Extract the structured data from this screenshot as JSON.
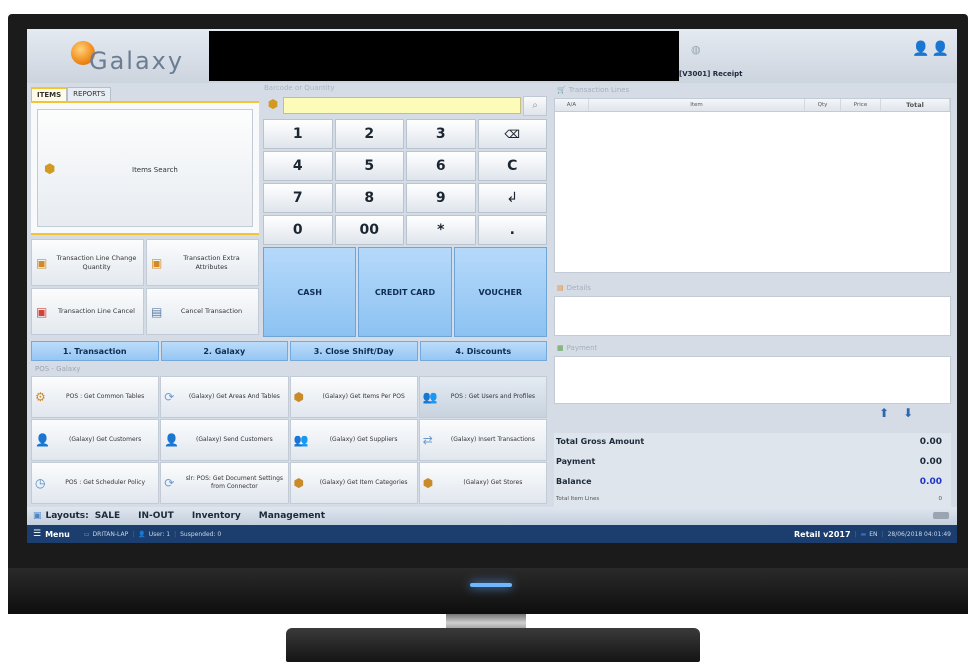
{
  "header": {
    "logo_text": "Galaxy",
    "receipt": "[V3001] Receipt"
  },
  "left_tabs": [
    "ITEMS",
    "REPORTS"
  ],
  "items_search": {
    "label": "Items Search"
  },
  "actions": [
    "Transaction Line Change Quantity",
    "Transaction Extra Attributes",
    "Transaction Line Cancel",
    "Cancel Transaction"
  ],
  "barcode": {
    "label": "Barcode or Quantity",
    "value": ""
  },
  "keypad": [
    "1",
    "2",
    "3",
    "⌫",
    "4",
    "5",
    "6",
    "C",
    "7",
    "8",
    "9",
    "↲",
    "0",
    "00",
    "*",
    "."
  ],
  "payments": [
    "CASH",
    "CREDIT CARD",
    "VOUCHER"
  ],
  "menu_tabs": [
    "1. Transaction",
    "2. Galaxy",
    "3. Close Shift/Day",
    "4. Discounts"
  ],
  "pos_section_label": "POS - Galaxy",
  "pos_buttons": [
    "POS : Get Common Tables",
    "(Galaxy) Get Areas And Tables",
    "(Galaxy) Get Items Per POS",
    "POS : Get Users and Profiles",
    "(Galaxy) Get Customers",
    "(Galaxy) Send Customers",
    "(Galaxy) Get Suppliers",
    "(Galaxy) Insert Transactions",
    "POS : Get Scheduler Policy",
    "slr: POS: Get Document Settings from Connector",
    "(Galaxy) Get Item Categories",
    "(Galaxy) Get Stores"
  ],
  "transaction_lines": {
    "label": "Transaction Lines",
    "columns": [
      "A/A",
      "Item",
      "Qty",
      "Price",
      "Total"
    ]
  },
  "details_label": "Details",
  "payment_label": "Payment",
  "totals": {
    "gross_label": "Total Gross Amount",
    "gross_value": "0.00",
    "payment_label": "Payment",
    "payment_value": "0.00",
    "balance_label": "Balance",
    "balance_value": "0.00",
    "lines_label": "Total Item Lines",
    "lines_value": "0"
  },
  "layouts": {
    "label": "Layouts:",
    "items": [
      "SALE",
      "IN-OUT",
      "Inventory",
      "Management"
    ]
  },
  "status": {
    "menu": "Menu",
    "computer": "DRITAN-LAP",
    "user": "User: 1",
    "suspended": "Suspended: 0",
    "version": "Retail  v2017",
    "lang": "EN",
    "datetime": "28/06/2018 04:01:49"
  },
  "colors": {
    "accent_blue": "#95c6f3",
    "status_bar": "#1b3e6e",
    "balance_blue": "#1f35c9"
  }
}
